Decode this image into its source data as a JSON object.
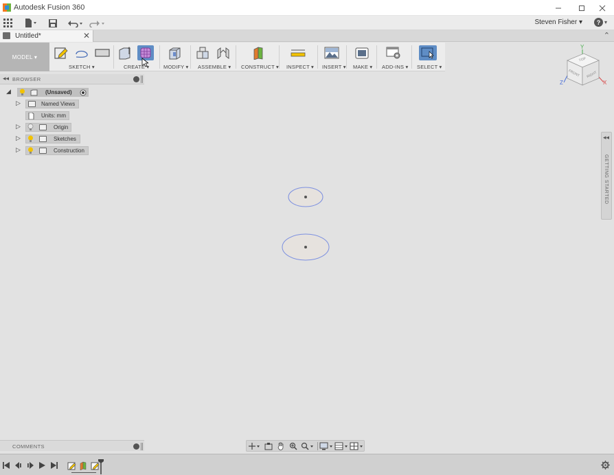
{
  "window": {
    "title": "Autodesk Fusion 360",
    "minimize_icon": "minimize-icon",
    "maximize_icon": "maximize-icon",
    "close_icon": "close-icon"
  },
  "qat": {
    "user_name": "Steven Fisher",
    "help_symbol": "?"
  },
  "document": {
    "tab_title": "Untitled*"
  },
  "ribbon": {
    "workspace": "MODEL ▾",
    "groups": [
      "SKETCH ▾",
      "CREATE ▾",
      "MODIFY ▾",
      "ASSEMBLE ▾",
      "CONSTRUCT ▾",
      "INSPECT ▾",
      "INSERT ▾",
      "MAKE ▾",
      "ADD-INS ▾",
      "SELECT ▾"
    ]
  },
  "browser": {
    "title": "BROWSER",
    "root": "(Unsaved)",
    "items": [
      "Named Views",
      "Units: mm",
      "Origin",
      "Sketches",
      "Construction"
    ]
  },
  "viewcube": {
    "top": "TOP",
    "front": "FRONT",
    "right": "RIGHT",
    "axis_x": "X",
    "axis_y": "Y",
    "axis_z": "Z"
  },
  "getting_started": {
    "label": "GETTING STARTED"
  },
  "comments": {
    "title": "COMMENTS"
  },
  "colors": {
    "accent": "#5f8dc5",
    "sketch_line": "#7b8fe0",
    "bulb": "#f2c200"
  }
}
